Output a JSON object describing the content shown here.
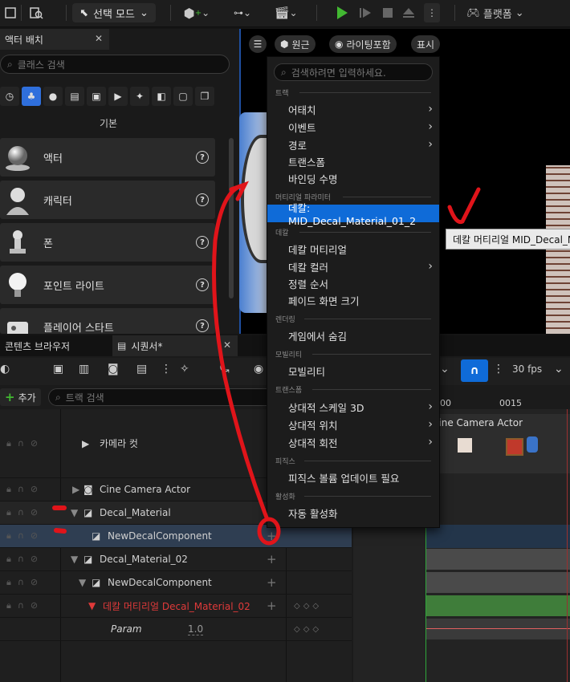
{
  "toolbar": {
    "mode_label": "선택 모드",
    "platform_label": "플랫폼"
  },
  "place_panel": {
    "tab_label": "액터 배치",
    "search_placeholder": "클래스 검색",
    "section_label": "기본",
    "items": [
      {
        "label": "액터",
        "icon": "sphere-icon"
      },
      {
        "label": "캐릭터",
        "icon": "character-icon"
      },
      {
        "label": "폰",
        "icon": "pawn-icon"
      },
      {
        "label": "포인트 라이트",
        "icon": "lightbulb-icon"
      },
      {
        "label": "플레이어 스타트",
        "icon": "player-start-icon"
      }
    ]
  },
  "viewport": {
    "perspective_label": "원근",
    "lighting_label": "라이팅포함",
    "show_label": "표시"
  },
  "context_menu": {
    "search_placeholder": "검색하려면 입력하세요.",
    "sections": [
      {
        "header": "트랙",
        "items": [
          {
            "label": "어태치",
            "submenu": true
          },
          {
            "label": "이벤트",
            "submenu": true
          },
          {
            "label": "경로",
            "submenu": true
          },
          {
            "label": "트랜스폼",
            "submenu": false
          },
          {
            "label": "바인딩 수명",
            "submenu": false
          }
        ]
      },
      {
        "header": "머티리얼 파라미터",
        "items": [
          {
            "label": "데칼: MID_Decal_Material_01_2",
            "submenu": false,
            "highlighted": true
          }
        ]
      },
      {
        "header": "데칼",
        "items": [
          {
            "label": "데칼 머티리얼",
            "submenu": false
          },
          {
            "label": "데칼 컬러",
            "submenu": true
          },
          {
            "label": "정렬 순서",
            "submenu": false
          },
          {
            "label": "페이드 화면 크기",
            "submenu": false
          }
        ]
      },
      {
        "header": "렌더링",
        "items": [
          {
            "label": "게임에서 숨김",
            "submenu": false
          }
        ]
      },
      {
        "header": "모빌리티",
        "items": [
          {
            "label": "모빌리티",
            "submenu": false
          }
        ]
      },
      {
        "header": "트랜스폼",
        "items": [
          {
            "label": "상대적 스케일 3D",
            "submenu": true
          },
          {
            "label": "상대적 위치",
            "submenu": true
          },
          {
            "label": "상대적 회전",
            "submenu": true
          }
        ]
      },
      {
        "header": "피직스",
        "items": [
          {
            "label": "피직스 볼륨 업데이트 필요",
            "submenu": false
          }
        ]
      },
      {
        "header": "활성화",
        "items": [
          {
            "label": "자동 활성화",
            "submenu": false
          }
        ]
      }
    ]
  },
  "tooltip": {
    "text": "데칼 머티리얼 MID_Decal_Ma"
  },
  "sequencer": {
    "tab_content_browser": "콘텐츠 브라우저",
    "tab_sequencer": "시퀀서*",
    "add_label": "추가",
    "track_search_placeholder": "트랙 검색",
    "fps_label": "30 fps",
    "timeline_ticks": [
      "00",
      "0015"
    ],
    "camera_actor_clip": "Cine Camera Actor",
    "tracks": [
      {
        "label": "카메라 컷"
      },
      {
        "label": "Cine Camera Actor"
      },
      {
        "label": "Decal_Material"
      },
      {
        "label": "NewDecalComponent"
      },
      {
        "label": "Decal_Material_02"
      },
      {
        "label": "NewDecalComponent"
      },
      {
        "label": "데칼 머티리얼 Decal_Material_02"
      },
      {
        "label": "Param",
        "value": "1.0"
      }
    ],
    "colors": {
      "accent_blue": "#0f6bd8",
      "track_green": "#3f7d3a",
      "annotation_red": "#e0141a",
      "material_red_text": "#e03a3a"
    }
  }
}
